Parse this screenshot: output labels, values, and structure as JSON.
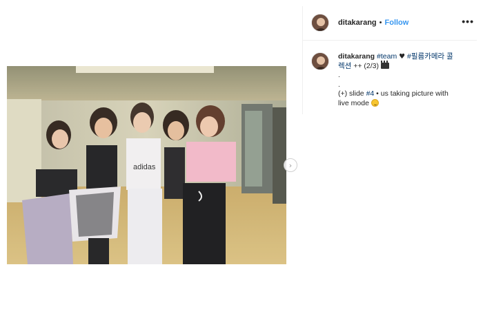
{
  "post": {
    "username": "ditakarang",
    "separator": "•",
    "follow_label": "Follow",
    "more_label": "•••",
    "next_arrow": "›",
    "caption": {
      "username": "ditakarang",
      "tag_team": "#team",
      "heart_icon": "♥",
      "tag_korean": "#필름카메라 콜",
      "line2_korean": "렉션",
      "line2_rest": "++ (2/3)",
      "dot1": ".",
      "dot2": ".",
      "slide_prefix": "(+) slide",
      "slide_tag": "#4",
      "slide_rest": "• us taking picture with",
      "slide_line2": "live mode"
    }
  },
  "colors": {
    "link": "#3897f0",
    "hashtag": "#003569",
    "text": "#262626",
    "border": "#efefef"
  },
  "icons": {
    "avatar": "avatar",
    "heart": "heart-icon",
    "clapper": "clapperboard-icon",
    "emoji": "upside-down-face-icon",
    "more": "more-options-icon",
    "next": "chevron-right-icon"
  }
}
